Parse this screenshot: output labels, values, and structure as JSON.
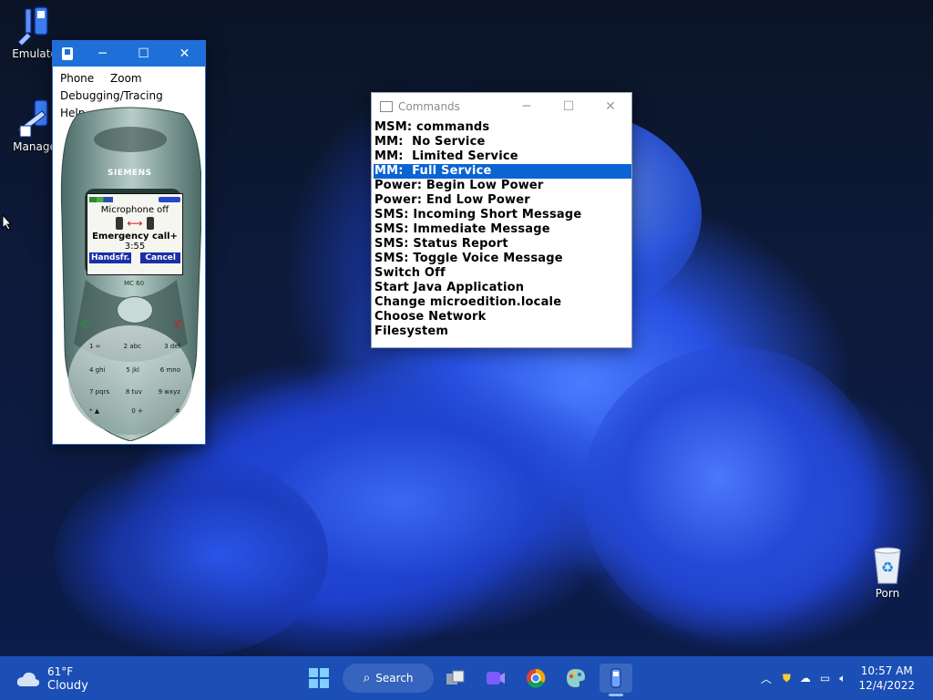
{
  "desktop": {
    "icons": [
      {
        "label": "Emulato"
      },
      {
        "label": "Manage"
      },
      {
        "label": "Porn"
      }
    ]
  },
  "emulator_window": {
    "menu": [
      "Phone",
      "Zoom",
      "Debugging/Tracing",
      "Help"
    ],
    "phone": {
      "brand": "SIEMENS",
      "model": "MC 60",
      "screen": {
        "status_line": "Microphone off",
        "call_label": "Emergency call+",
        "timer": "3:55",
        "softkey_left": "Handsfr.",
        "softkey_right": "Cancel"
      },
      "keys": [
        "1 ∞",
        "2 abc",
        "3 def",
        "4 ghi",
        "5 jkl",
        "6 mno",
        "7 pqrs",
        "8 tuv",
        "9 wxyz",
        "* ▲",
        "0 +",
        "#"
      ]
    }
  },
  "commands_window": {
    "title": "Commands",
    "selected_index": 3,
    "items": [
      "MSM: commands",
      "MM:  No Service",
      "MM:  Limited Service",
      "MM:  Full Service",
      "Power: Begin Low Power",
      "Power: End Low Power",
      "SMS: Incoming Short Message",
      "SMS: Immediate Message",
      "SMS: Status Report",
      "SMS: Toggle Voice Message",
      "Switch Off",
      "Start Java Application",
      "Change microedition.locale",
      "Choose Network",
      "Filesystem"
    ]
  },
  "taskbar": {
    "weather": {
      "temp": "61°F",
      "condition": "Cloudy"
    },
    "search_label": "Search",
    "clock": {
      "time": "10:57 AM",
      "date": "12/4/2022"
    }
  },
  "colors": {
    "accent": "#1f6fd8",
    "selection": "#0a64d4",
    "taskbar": "#1b4fb5"
  }
}
